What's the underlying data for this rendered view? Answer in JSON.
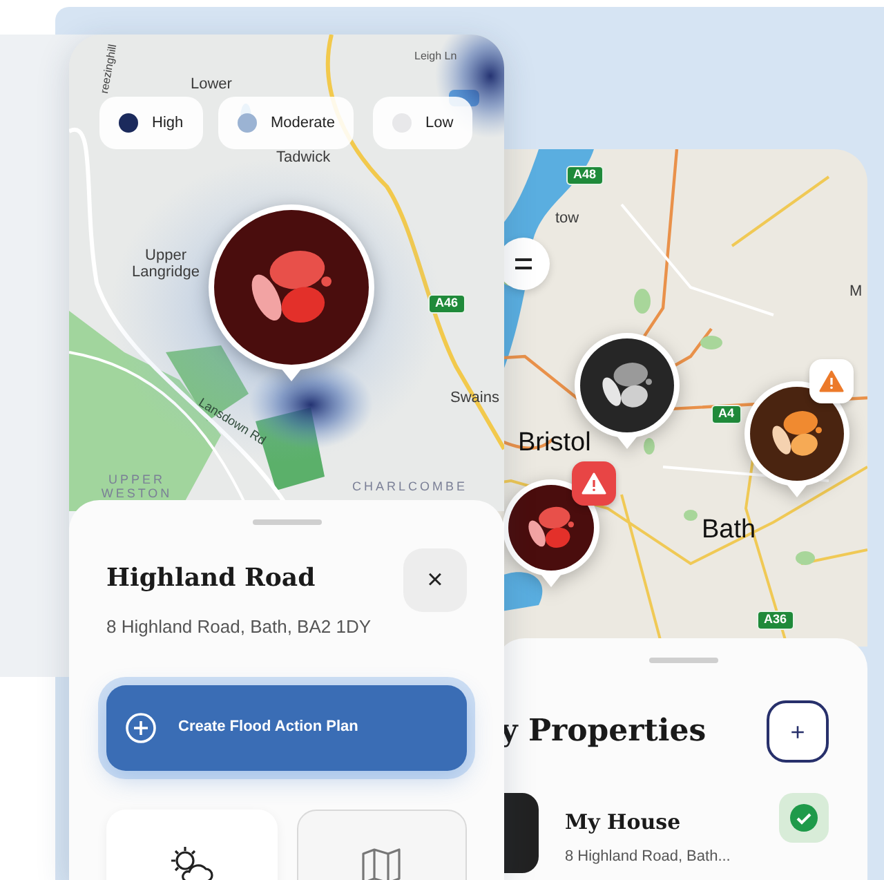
{
  "front_phone": {
    "map_labels": [
      {
        "text": "reezinghill",
        "kind": "vertical"
      },
      {
        "text": "Lower",
        "kind": "place"
      },
      {
        "text": "Leigh Ln",
        "kind": "street"
      },
      {
        "text": "Tadwick",
        "kind": "place"
      },
      {
        "text": "Upper Langridge",
        "kind": "place"
      },
      {
        "text": "Swains",
        "kind": "place"
      },
      {
        "text": "A46",
        "kind": "shield"
      },
      {
        "text": "Lansdown Rd",
        "kind": "slanted"
      },
      {
        "text": "UPPER WESTON",
        "kind": "district"
      },
      {
        "text": "CHARLCOMBE",
        "kind": "district"
      }
    ],
    "legend": [
      {
        "label": "High",
        "color": "#1b2a5c"
      },
      {
        "label": "Moderate",
        "color": "#9bb3d3"
      },
      {
        "label": "Low",
        "color": "#e8e8ea"
      }
    ],
    "pin": {
      "kind": "high"
    },
    "sheet": {
      "title": "Highland Road",
      "address": "8 Highland Road, Bath, BA2 1DY",
      "close": "×",
      "action": "Create Flood Action Plan"
    }
  },
  "back_phone": {
    "map_labels": [
      {
        "text": "A48",
        "kind": "shield"
      },
      {
        "text": "tow",
        "kind": "place"
      },
      {
        "text": "Bristol",
        "kind": "city"
      },
      {
        "text": "Bath",
        "kind": "city"
      },
      {
        "text": "A4",
        "kind": "shield"
      },
      {
        "text": "A36",
        "kind": "shield"
      },
      {
        "text": "M",
        "kind": "place"
      }
    ],
    "pins": [
      {
        "kind": "none",
        "warning": false
      },
      {
        "kind": "moderate",
        "warning": true
      },
      {
        "kind": "high",
        "warning": true
      }
    ],
    "sheet": {
      "title": "y Properties",
      "add": "+",
      "properties": [
        {
          "name": "My House",
          "address": "8 Highland Road, Bath...",
          "checked": true
        }
      ]
    }
  }
}
